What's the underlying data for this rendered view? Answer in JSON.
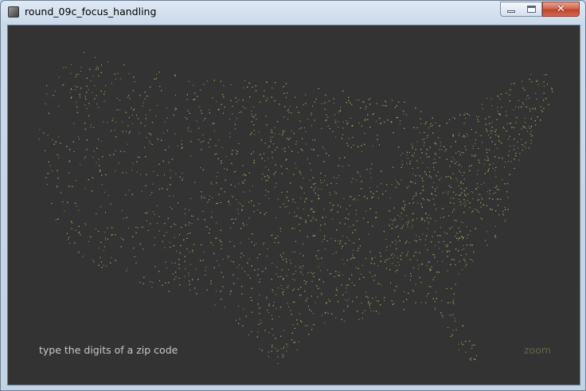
{
  "window": {
    "title": "round_09c_focus_handling",
    "controls": {
      "minimize": "minimize",
      "maximize": "maximize",
      "close": "✕"
    }
  },
  "sketch": {
    "background": "#333333",
    "dot_color": "#9a9a5a",
    "map_content": "dot map of zip code locations in the continental United States",
    "prompt": "type the digits of a zip code",
    "zoom_label": "zoom",
    "zoom_color": "#656347"
  }
}
